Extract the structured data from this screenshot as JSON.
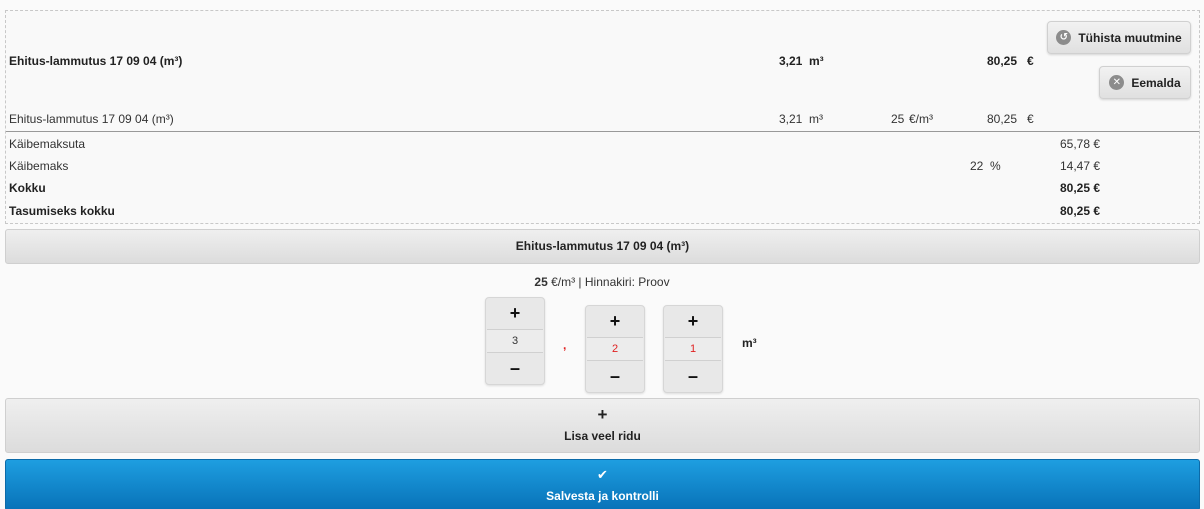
{
  "summary": {
    "main_row": {
      "name": "Ehitus-lammutus 17 09 04 (m³)",
      "qty": "3,21",
      "unit": "m³",
      "total": "80,25",
      "currency": "€"
    },
    "detail_row": {
      "name": "Ehitus-lammutus 17 09 04 (m³)",
      "qty": "3,21",
      "unit": "m³",
      "price": "25",
      "price_unit": "€/m³",
      "total": "80,25",
      "currency": "€"
    },
    "totals": [
      {
        "label": "Käibemaksuta",
        "rate": "",
        "value": "65,78 €",
        "bold": false
      },
      {
        "label": "Käibemaks",
        "rate": "22  %",
        "value": "14,47 €",
        "bold": false
      },
      {
        "label": "Kokku",
        "rate": "",
        "value": "80,25 €",
        "bold": true
      },
      {
        "label": "Tasumiseks kokku",
        "rate": "",
        "value": "80,25 €",
        "bold": true
      }
    ],
    "cancel_button": "Tühista muutmine",
    "remove_button": "Eemalda"
  },
  "editor": {
    "title": "Ehitus-lammutus 17 09 04 (m³)",
    "price_value": "25",
    "price_rest": " €/m³ | Hinnakiri: Proov",
    "separator": ",",
    "digits": [
      "3",
      "2",
      "1"
    ],
    "unit": "m³",
    "plus_symbol": "+",
    "minus_symbol": "–"
  },
  "actions": {
    "add_plus": "+",
    "add_label": "Lisa veel ridu",
    "save_check": "✔",
    "save_label": "Salvesta ja kontrolli"
  },
  "colors": {
    "accent_blue": "#0d86cf",
    "digit_red": "#e02020"
  }
}
